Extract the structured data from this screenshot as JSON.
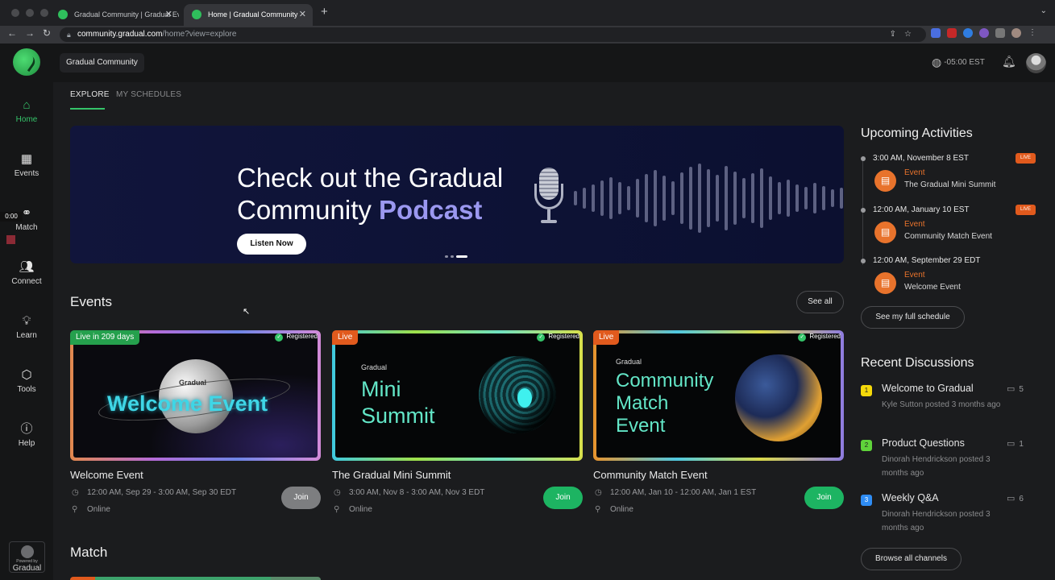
{
  "browser": {
    "tabs": [
      {
        "title": "Gradual Community | Gradual Ev"
      },
      {
        "title": "Home | Gradual Community"
      }
    ],
    "url_host": "community.gradual.com",
    "url_path": "/home?view=explore"
  },
  "recording": {
    "time": "0:00"
  },
  "sidebar": {
    "items": [
      {
        "label": "Home",
        "icon": "home-icon",
        "active": true
      },
      {
        "label": "Events",
        "icon": "calendar-icon"
      },
      {
        "label": "Match",
        "icon": "match-icon"
      },
      {
        "label": "Connect",
        "icon": "people-icon"
      },
      {
        "label": "Learn",
        "icon": "lightbulb-icon"
      },
      {
        "label": "Tools",
        "icon": "cube-icon"
      },
      {
        "label": "Help",
        "icon": "help-icon"
      }
    ],
    "powered_small": "Powered by",
    "powered_brand": "Gradual"
  },
  "topbar": {
    "community": "Gradual Community",
    "timezone": "-05:00 EST"
  },
  "page_tabs": [
    "EXPLORE",
    "MY SCHEDULES"
  ],
  "banner": {
    "title_line1": "Check out the Gradual",
    "title_line2": "Community ",
    "title_highlight": "Podcast",
    "button": "Listen Now"
  },
  "events": {
    "title": "Events",
    "see_all": "See all",
    "registered": "Registered",
    "join": "Join",
    "cards": [
      {
        "badge": "Live in 209 days",
        "thumb_small": "Gradual",
        "thumb_big": "Welcome Event",
        "name": "Welcome Event",
        "date": "12:00 AM, Sep 29 - 3:00 AM, Sep 30 EDT",
        "location": "Online"
      },
      {
        "badge": "Live",
        "thumb_small": "Gradual",
        "thumb_big_1": "Mini",
        "thumb_big_2": "Summit",
        "name": "The Gradual Mini Summit",
        "date": "3:00 AM, Nov 8 - 3:00 AM, Nov 3 EDT",
        "location": "Online"
      },
      {
        "badge": "Live",
        "thumb_small": "Gradual",
        "thumb_big_1": "Community",
        "thumb_big_2": "Match",
        "thumb_big_3": "Event",
        "name": "Community Match Event",
        "date": "12:00 AM, Jan 10 - 12:00 AM, Jan 1 EST",
        "location": "Online"
      }
    ]
  },
  "match": {
    "title": "Match"
  },
  "upcoming": {
    "title": "Upcoming Activities",
    "live_label": "LIVE",
    "items": [
      {
        "when": "3:00 AM, November 8 EST",
        "kind": "Event",
        "name": "The Gradual Mini Summit",
        "live": true
      },
      {
        "when": "12:00 AM, January 10 EST",
        "kind": "Event",
        "name": "Community Match Event",
        "live": true
      },
      {
        "when": "12:00 AM, September 29 EDT",
        "kind": "Event",
        "name": "Welcome Event",
        "live": false
      }
    ],
    "full_schedule": "See my full schedule"
  },
  "discussions": {
    "title": "Recent Discussions",
    "items": [
      {
        "num": "1",
        "color": "#f5d90a",
        "title": "Welcome to Gradual",
        "meta": "Kyle Sutton posted 3 months ago",
        "count": "5"
      },
      {
        "num": "2",
        "color": "#5fd33a",
        "title": "Product Questions",
        "meta": "Dinorah Hendrickson posted 3 months ago",
        "count": "1"
      },
      {
        "num": "3",
        "color": "#2f8df5",
        "title": "Weekly Q&A",
        "meta": "Dinorah Hendrickson posted 3 months ago",
        "count": "6"
      }
    ],
    "browse": "Browse all channels"
  },
  "colors": {
    "accent": "#35c46a",
    "live": "#e15a1d",
    "event_orange": "#e8732c"
  }
}
